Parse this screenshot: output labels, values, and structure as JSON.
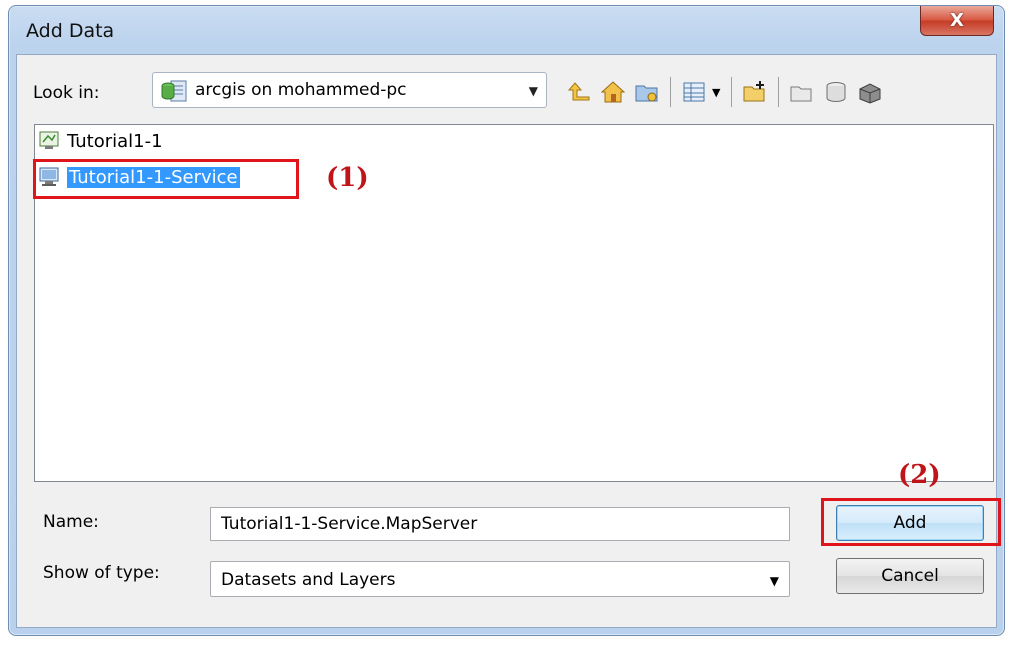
{
  "window": {
    "title": "Add Data",
    "close_label": "X"
  },
  "lookin": {
    "label": "Look in:",
    "value": "arcgis on mohammed-pc"
  },
  "toolbar": {
    "icons": [
      "up-one-level-icon",
      "home-icon",
      "connect-folder-icon",
      "view-list-icon",
      "new-folder-icon",
      "catalog-icon",
      "database-icon",
      "toolbox-icon"
    ]
  },
  "files": [
    {
      "name": "Tutorial1-1",
      "selected": false
    },
    {
      "name": "Tutorial1-1-Service",
      "selected": true
    }
  ],
  "annotations": {
    "step1": "(1)",
    "step2": "(2)",
    "color": "#e0141b"
  },
  "form": {
    "name_label": "Name:",
    "name_value": "Tutorial1-1-Service.MapServer",
    "type_label": "Show of type:",
    "type_value": "Datasets and Layers"
  },
  "buttons": {
    "add": "Add",
    "cancel": "Cancel"
  },
  "colors": {
    "selection": "#3399ff",
    "title_gradient": "#bcd3ee",
    "close_button": "#c53b25"
  }
}
